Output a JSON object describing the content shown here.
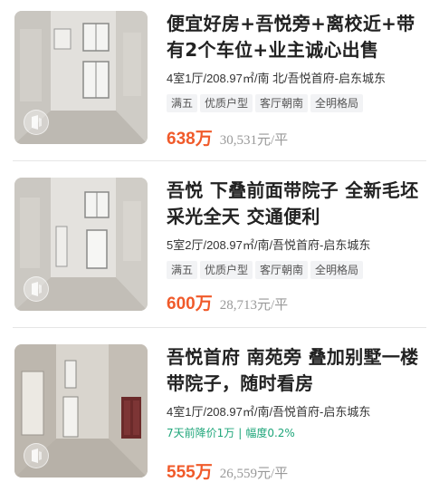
{
  "listings": [
    {
      "title": "便宜好房+吾悦旁+离校近+带有2个车位+业主诚心出售",
      "meta": "4室1厅/208.97㎡/南 北/吾悦首府-启东城东",
      "tags": [
        "满五",
        "优质户型",
        "客厅朝南",
        "全明格局"
      ],
      "price": "638万",
      "unit_price": "30,531元/平"
    },
    {
      "title": "吾悦 下叠前面带院子 全新毛坯 采光全天 交通便利",
      "meta": "5室2厅/208.97㎡/南/吾悦首府-启东城东",
      "tags": [
        "满五",
        "优质户型",
        "客厅朝南",
        "全明格局"
      ],
      "price": "600万",
      "unit_price": "28,713元/平"
    },
    {
      "title": "吾悦首府 南苑旁 叠加别墅一楼带院子，随时看房",
      "meta": "4室1厅/208.97㎡/南/吾悦首府-启东城东",
      "price_drop": {
        "text": "7天前降价1万",
        "separator": "|",
        "range": "幅度0.2%"
      },
      "price": "555万",
      "unit_price": "26,559元/平"
    }
  ],
  "colors": {
    "price": "#f05a2a",
    "drop": "#1fa67a",
    "tag_bg": "#f2f3f5"
  },
  "icons": {
    "thumb_badge": "vr-panorama-icon"
  }
}
